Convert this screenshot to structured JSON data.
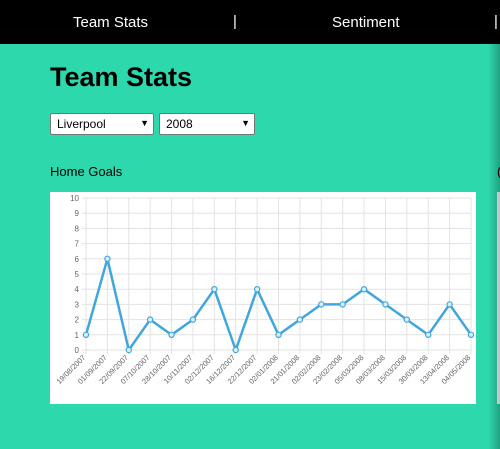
{
  "nav": {
    "items": [
      {
        "label": "Team Stats"
      },
      {
        "label": "Sentiment"
      }
    ],
    "separator": "|"
  },
  "page": {
    "title": "Team Stats"
  },
  "filters": {
    "team": "Liverpool",
    "season": "2008"
  },
  "colors": {
    "background": "#2dd8ad",
    "navbar": "#000000",
    "line": "#41a6de"
  },
  "chart_data": {
    "type": "line",
    "title": "Home Goals",
    "xlabel": "",
    "ylabel": "",
    "ylim": [
      0,
      10
    ],
    "grid": true,
    "x": [
      "19/08/2007",
      "01/09/2007",
      "22/09/2007",
      "07/10/2007",
      "28/10/2007",
      "10/11/2007",
      "02/12/2007",
      "16/12/2007",
      "22/12/2007",
      "02/01/2008",
      "21/01/2008",
      "02/02/2008",
      "23/02/2008",
      "05/03/2008",
      "08/03/2008",
      "15/03/2008",
      "30/03/2008",
      "13/04/2008",
      "04/05/2008"
    ],
    "yticks": [
      0,
      1,
      2,
      3,
      4,
      5,
      6,
      7,
      8,
      9,
      10
    ],
    "series": [
      {
        "values": [
          1,
          6,
          0,
          2,
          1,
          2,
          4,
          0,
          4,
          1,
          2,
          3,
          3,
          4,
          3,
          2,
          1,
          3,
          1
        ]
      }
    ]
  }
}
